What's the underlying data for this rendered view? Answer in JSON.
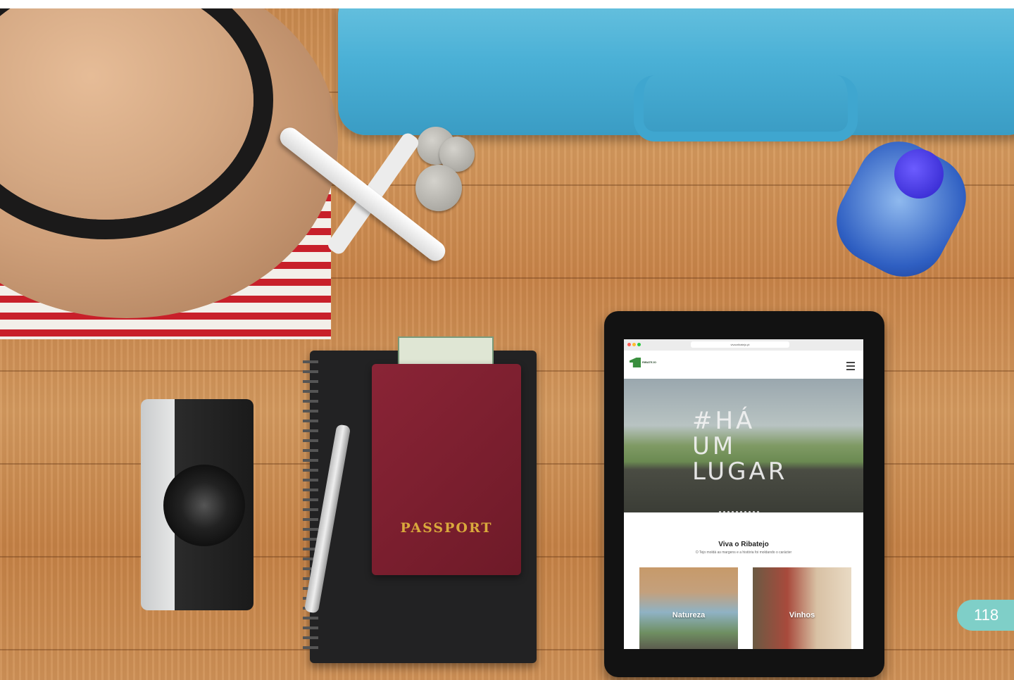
{
  "passport": {
    "label": "PASSPORT"
  },
  "browser": {
    "url": "vivaoribatejo.pt"
  },
  "site": {
    "logo_text": "RIBATEJO",
    "hero_title_lines": [
      "#HÁ",
      "UM",
      "LUGAR"
    ],
    "section_title": "Viva o Ribatejo",
    "section_subtitle": "O Tejo moldá as margens e a história foi moldando o carácter",
    "cards": [
      {
        "label": "Natureza"
      },
      {
        "label": "Vinhos"
      }
    ]
  },
  "page_number": "118",
  "colors": {
    "badge": "#7fcfc8",
    "passport": "#7a1f2f",
    "passport_text": "#d9a93c",
    "suitcase": "#4ab0d6",
    "logo_green": "#3a8f3e"
  }
}
